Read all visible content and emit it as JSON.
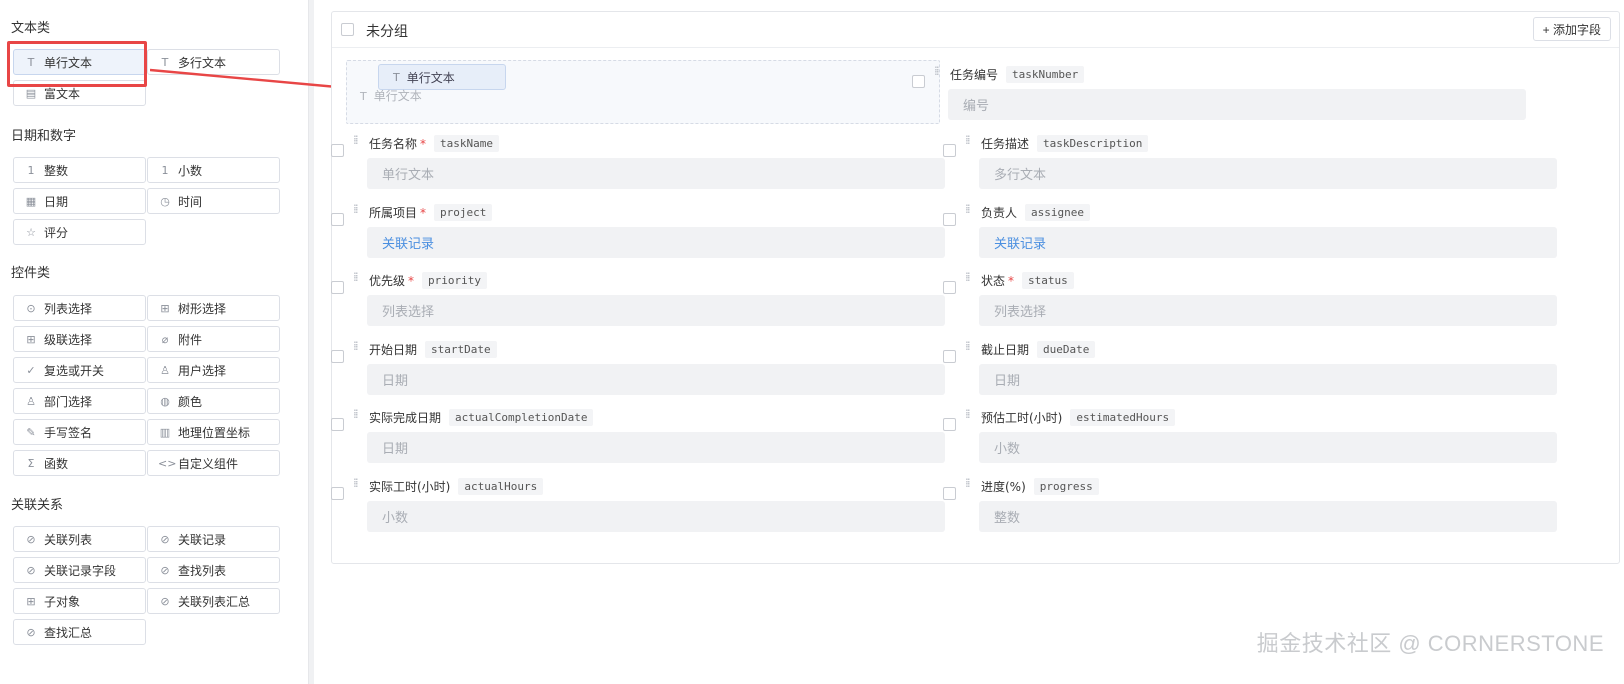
{
  "palette": {
    "sections": [
      {
        "title": "文本类",
        "items": [
          {
            "label": "单行文本",
            "icon": "text-icon",
            "glyph": "T"
          },
          {
            "label": "多行文本",
            "icon": "text-icon",
            "glyph": "T"
          },
          {
            "label": "富文本",
            "icon": "rich-text-icon",
            "glyph": "▤"
          }
        ]
      },
      {
        "title": "日期和数字",
        "items": [
          {
            "label": "整数",
            "icon": "integer-icon",
            "glyph": "1"
          },
          {
            "label": "小数",
            "icon": "decimal-icon",
            "glyph": "1"
          },
          {
            "label": "日期",
            "icon": "calendar-icon",
            "glyph": "▦"
          },
          {
            "label": "时间",
            "icon": "clock-icon",
            "glyph": "◷"
          },
          {
            "label": "评分",
            "icon": "star-icon",
            "glyph": "☆"
          }
        ]
      },
      {
        "title": "控件类",
        "items": [
          {
            "label": "列表选择",
            "icon": "check-circle-icon",
            "glyph": "⊙"
          },
          {
            "label": "树形选择",
            "icon": "tree-icon",
            "glyph": "⊞"
          },
          {
            "label": "级联选择",
            "icon": "cascade-icon",
            "glyph": "⊞"
          },
          {
            "label": "附件",
            "icon": "paperclip-icon",
            "glyph": "⌀"
          },
          {
            "label": "复选或开关",
            "icon": "checkmark-icon",
            "glyph": "✓"
          },
          {
            "label": "用户选择",
            "icon": "user-icon",
            "glyph": "♙"
          },
          {
            "label": "部门选择",
            "icon": "department-icon",
            "glyph": "♙"
          },
          {
            "label": "颜色",
            "icon": "palette-icon",
            "glyph": "◍"
          },
          {
            "label": "手写签名",
            "icon": "pen-icon",
            "glyph": "✎"
          },
          {
            "label": "地理位置坐标",
            "icon": "map-icon",
            "glyph": "▥"
          },
          {
            "label": "函数",
            "icon": "sigma-icon",
            "glyph": "Σ"
          },
          {
            "label": "自定义组件",
            "icon": "code-icon",
            "glyph": "<>"
          }
        ]
      },
      {
        "title": "关联关系",
        "items": [
          {
            "label": "关联列表",
            "icon": "link-icon",
            "glyph": "⊘"
          },
          {
            "label": "关联记录",
            "icon": "link-icon",
            "glyph": "⊘"
          },
          {
            "label": "关联记录字段",
            "icon": "link-icon",
            "glyph": "⊘"
          },
          {
            "label": "查找列表",
            "icon": "link-icon",
            "glyph": "⊘"
          },
          {
            "label": "子对象",
            "icon": "tree-icon",
            "glyph": "⊞"
          },
          {
            "label": "关联列表汇总",
            "icon": "link-icon",
            "glyph": "⊘"
          },
          {
            "label": "查找汇总",
            "icon": "link-icon",
            "glyph": "⊘"
          }
        ]
      }
    ]
  },
  "form": {
    "group_title": "未分组",
    "add_field_label": "+ 添加字段",
    "drag_chip_label": "单行文本",
    "drop_ghost_label": "单行文本",
    "fields": [
      {
        "label": "任务编号",
        "key": "taskNumber",
        "required": false,
        "placeholder": "编号",
        "link": false
      },
      {
        "label": "任务名称",
        "key": "taskName",
        "required": true,
        "placeholder": "单行文本",
        "link": false
      },
      {
        "label": "任务描述",
        "key": "taskDescription",
        "required": false,
        "placeholder": "多行文本",
        "link": false
      },
      {
        "label": "所属项目",
        "key": "project",
        "required": true,
        "placeholder": "关联记录",
        "link": true
      },
      {
        "label": "负责人",
        "key": "assignee",
        "required": false,
        "placeholder": "关联记录",
        "link": true
      },
      {
        "label": "优先级",
        "key": "priority",
        "required": true,
        "placeholder": "列表选择",
        "link": false
      },
      {
        "label": "状态",
        "key": "status",
        "required": true,
        "placeholder": "列表选择",
        "link": false
      },
      {
        "label": "开始日期",
        "key": "startDate",
        "required": false,
        "placeholder": "日期",
        "link": false
      },
      {
        "label": "截止日期",
        "key": "dueDate",
        "required": false,
        "placeholder": "日期",
        "link": false
      },
      {
        "label": "实际完成日期",
        "key": "actualCompletionDate",
        "required": false,
        "placeholder": "日期",
        "link": false
      },
      {
        "label": "预估工时(小时)",
        "key": "estimatedHours",
        "required": false,
        "placeholder": "小数",
        "link": false
      },
      {
        "label": "实际工时(小时)",
        "key": "actualHours",
        "required": false,
        "placeholder": "小数",
        "link": false
      },
      {
        "label": "进度(%)",
        "key": "progress",
        "required": false,
        "placeholder": "整数",
        "link": false
      }
    ]
  },
  "watermark": "掘金技术社区 @ CORNERSTONE",
  "colors": {
    "accent_link": "#4a8fe0",
    "required_star": "#e84646",
    "highlight": "#e84646"
  }
}
